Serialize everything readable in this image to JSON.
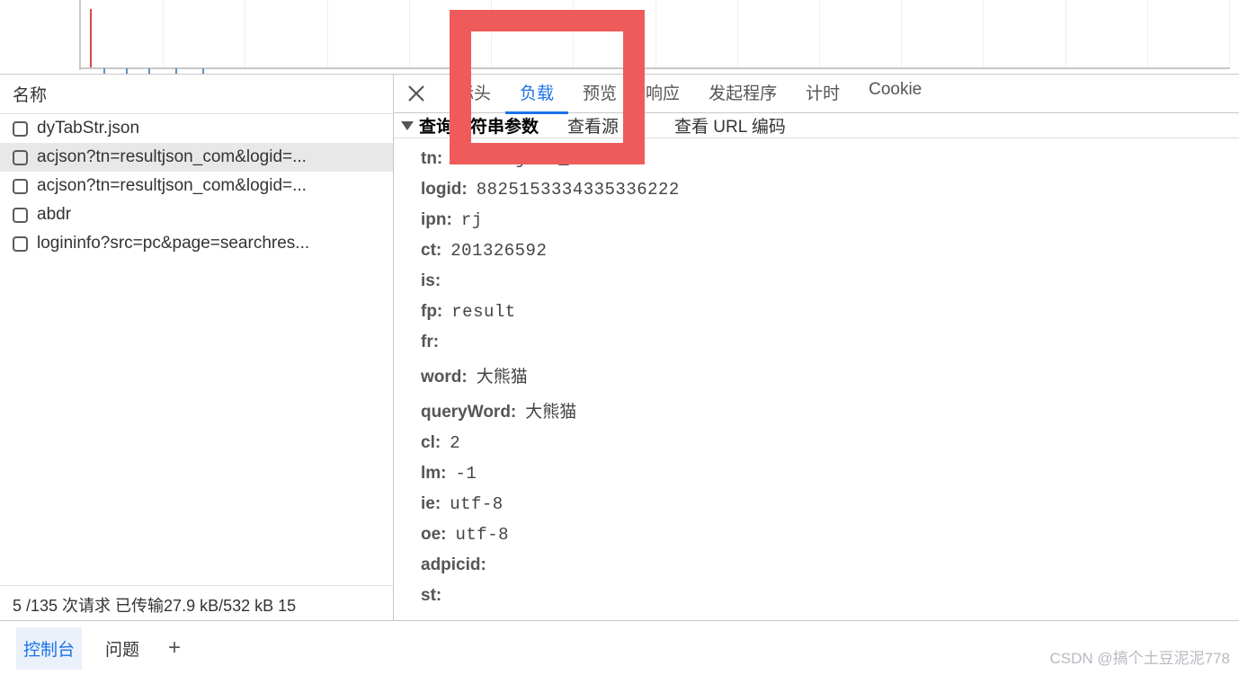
{
  "left": {
    "header": "名称",
    "requests": [
      {
        "name": "dyTabStr.json",
        "selected": false
      },
      {
        "name": "acjson?tn=resultjson_com&logid=...",
        "selected": true
      },
      {
        "name": "acjson?tn=resultjson_com&logid=...",
        "selected": false
      },
      {
        "name": "abdr",
        "selected": false
      },
      {
        "name": "logininfo?src=pc&page=searchres...",
        "selected": false
      }
    ],
    "status": "5 /135 次请求  已传输27.9 kB/532 kB  15"
  },
  "right": {
    "tabs": [
      {
        "label": "标头",
        "active": false
      },
      {
        "label": "负载",
        "active": true
      },
      {
        "label": "预览",
        "active": false
      },
      {
        "label": "响应",
        "active": false
      },
      {
        "label": "发起程序",
        "active": false
      },
      {
        "label": "计时",
        "active": false
      },
      {
        "label": "Cookie",
        "active": false
      }
    ],
    "subheader": {
      "title": "查询字符串参数",
      "view_source": "查看源",
      "view_urlencoded": "查看 URL 编码"
    },
    "params": [
      {
        "key": "tn:",
        "val": "resultjson_com",
        "mono": true
      },
      {
        "key": "logid:",
        "val": "8825153334335336222",
        "mono": true
      },
      {
        "key": "ipn:",
        "val": "rj",
        "mono": true
      },
      {
        "key": "ct:",
        "val": "201326592",
        "mono": true
      },
      {
        "key": "is:",
        "val": "",
        "mono": true
      },
      {
        "key": "fp:",
        "val": "result",
        "mono": true
      },
      {
        "key": "fr:",
        "val": "",
        "mono": true
      },
      {
        "key": "word:",
        "val": "大熊猫",
        "mono": false
      },
      {
        "key": "queryWord:",
        "val": "大熊猫",
        "mono": false
      },
      {
        "key": "cl:",
        "val": "2",
        "mono": true
      },
      {
        "key": "lm:",
        "val": "-1",
        "mono": true
      },
      {
        "key": "ie:",
        "val": "utf-8",
        "mono": true
      },
      {
        "key": "oe:",
        "val": "utf-8",
        "mono": true
      },
      {
        "key": "adpicid:",
        "val": "",
        "mono": true
      },
      {
        "key": "st:",
        "val": "",
        "mono": true
      }
    ]
  },
  "drawer": {
    "tabs": [
      {
        "label": "控制台",
        "active": true
      },
      {
        "label": "问题",
        "active": false
      }
    ]
  },
  "watermark": "CSDN @搞个土豆泥泥778"
}
